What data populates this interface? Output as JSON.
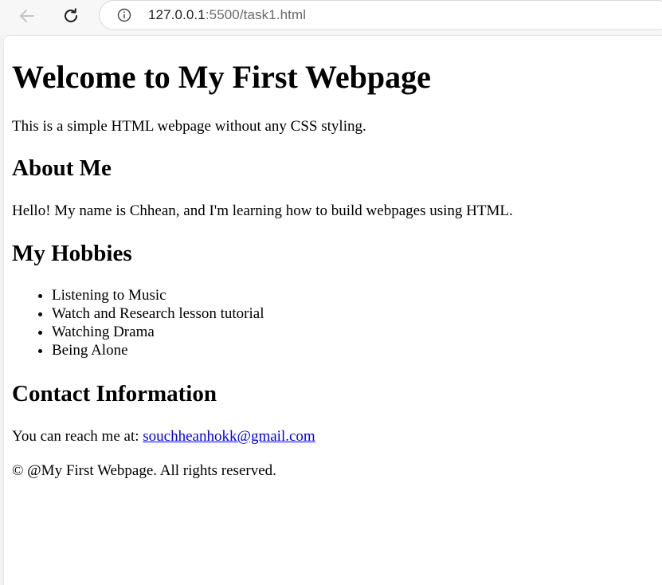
{
  "browser": {
    "url_host": "127.0.0.1",
    "url_rest": ":5500/task1.html"
  },
  "page": {
    "title": "Welcome to My First Webpage",
    "intro": "This is a simple HTML webpage without any CSS styling.",
    "about_heading": "About Me",
    "about_text": "Hello! My name is Chhean, and I'm learning how to build webpages using HTML.",
    "hobbies_heading": "My Hobbies",
    "hobbies": [
      "Listening to Music",
      "Watch and Research lesson tutorial",
      "Watching Drama",
      "Being Alone"
    ],
    "contact_heading": "Contact Information",
    "contact_prefix": "You can reach me at: ",
    "contact_email": "souchheanhokk@gmail.com",
    "footer": "© @My First Webpage. All rights reserved."
  },
  "icons": {
    "back": "arrow-left-icon",
    "reload": "reload-icon",
    "info": "info-circle-icon"
  },
  "colors": {
    "link": "#0000ee",
    "url_host": "#1f1f1f",
    "url_rest": "#6a6a6a"
  }
}
